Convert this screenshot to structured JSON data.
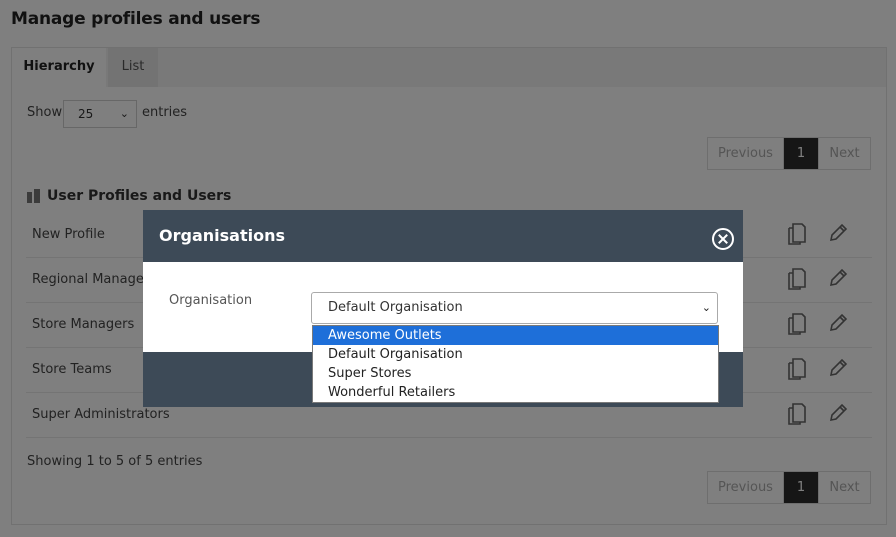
{
  "page": {
    "title": "Manage profiles and users",
    "tabs": [
      "Hierarchy",
      "List"
    ],
    "show_label": "Show",
    "entries_value": "25",
    "entries_label": "entries",
    "pager": {
      "previous": "Previous",
      "page": "1",
      "next": "Next"
    },
    "section_title": "User Profiles and Users",
    "rows": [
      {
        "name": "New Profile"
      },
      {
        "name": "Regional Managers"
      },
      {
        "name": "Store Managers"
      },
      {
        "name": "Store Teams"
      },
      {
        "name": "Super Administrators"
      }
    ],
    "showing_text": "Showing 1 to 5 of 5 entries"
  },
  "modal": {
    "title": "Organisations",
    "org_label": "Organisation",
    "org_value": "Default Organisation",
    "options": [
      "Awesome Outlets",
      "Default Organisation",
      "Super Stores",
      "Wonderful Retailers"
    ],
    "highlighted_option": "Awesome Outlets"
  },
  "colors": {
    "modal_header": "#3d4a57",
    "highlight": "#1e6fd9",
    "pager_active": "#2c2c2c"
  }
}
